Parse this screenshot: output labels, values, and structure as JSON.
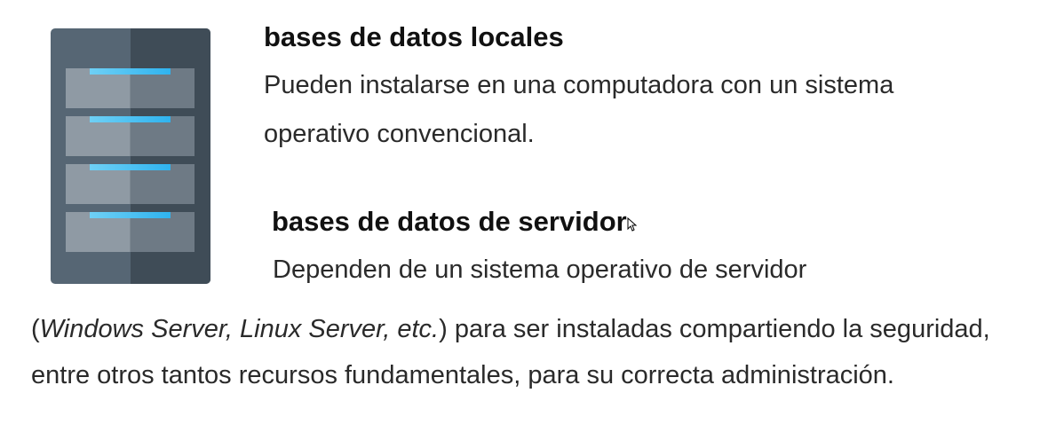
{
  "illustration": {
    "icon": "server-rack-icon",
    "colors": {
      "body": "#566674",
      "shade": "#3f4c57",
      "led": "#7bc043",
      "slot": "#2fb3ef"
    }
  },
  "local": {
    "title": "bases de datos locales",
    "line1": "Pueden instalarse en una computadora con un sistema",
    "line2": "operativo convencional."
  },
  "server": {
    "title": "bases de datos de servidor",
    "line1": "Dependen de un sistema operativo de servidor",
    "paren_open": "(",
    "italic": "Windows Server, Linux Server, etc.",
    "rest": ") para ser instaladas compartiendo la seguridad, entre otros tantos recursos fundamentales, para su correcta administración."
  }
}
